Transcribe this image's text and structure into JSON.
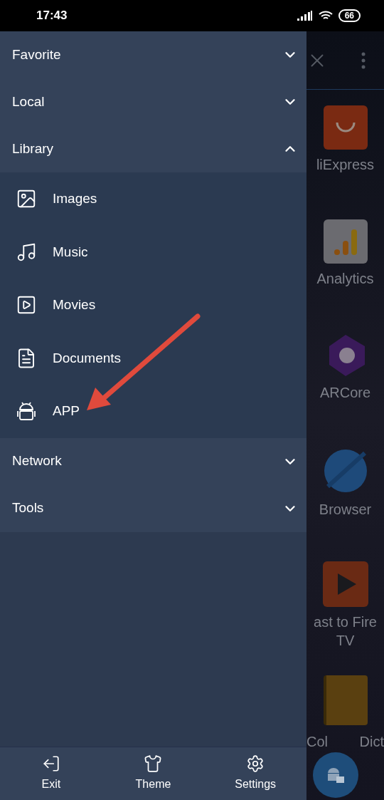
{
  "status_bar": {
    "time": "17:43",
    "battery": "66"
  },
  "drawer": {
    "sections": [
      {
        "label": "Favorite",
        "expanded": false
      },
      {
        "label": "Local",
        "expanded": false
      },
      {
        "label": "Library",
        "expanded": true,
        "children": [
          {
            "label": "Images",
            "kind": "image"
          },
          {
            "label": "Music",
            "kind": "music"
          },
          {
            "label": "Movies",
            "kind": "movie"
          },
          {
            "label": "Documents",
            "kind": "document"
          },
          {
            "label": "APP",
            "kind": "android"
          }
        ]
      },
      {
        "label": "Network",
        "expanded": false
      },
      {
        "label": "Tools",
        "expanded": false
      }
    ],
    "footer": [
      {
        "label": "Exit",
        "kind": "exit"
      },
      {
        "label": "Theme",
        "kind": "theme"
      },
      {
        "label": "Settings",
        "kind": "settings"
      }
    ]
  },
  "background_apps": [
    {
      "label": "liExpress",
      "kind": "aliexpress"
    },
    {
      "label": "Analytics",
      "kind": "analytics"
    },
    {
      "label": "ARCore",
      "kind": "arcore"
    },
    {
      "label": "Browser",
      "kind": "browser"
    },
    {
      "label": "ast to Fire TV",
      "kind": "firecast"
    },
    {
      "label_start": "Col",
      "label_end": "Dict",
      "kind": "dict"
    }
  ]
}
